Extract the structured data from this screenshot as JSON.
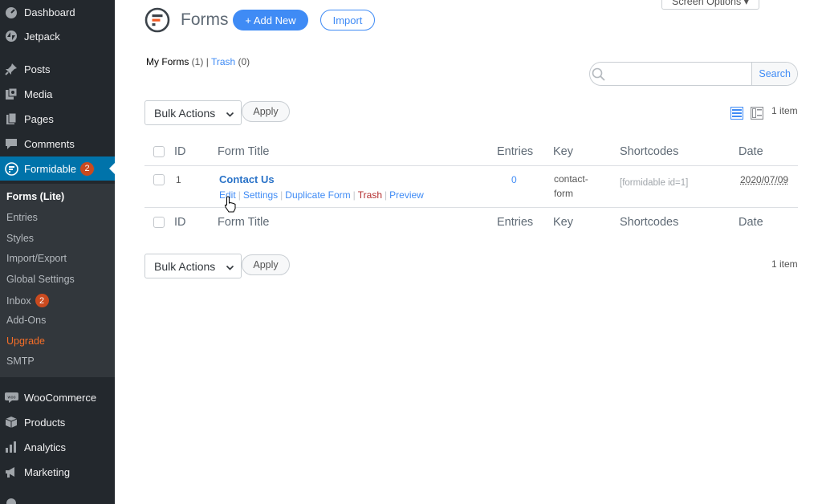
{
  "sidebar": {
    "top_items": [
      {
        "label": "Dashboard",
        "icon": "dashboard-icon"
      },
      {
        "label": "Jetpack",
        "icon": "jetpack-icon"
      },
      {
        "label": "Posts",
        "icon": "pin-icon"
      },
      {
        "label": "Media",
        "icon": "media-icon"
      },
      {
        "label": "Pages",
        "icon": "pages-icon"
      },
      {
        "label": "Comments",
        "icon": "comment-icon"
      },
      {
        "label": "Formidable",
        "icon": "formidable-icon",
        "badge": "2"
      }
    ],
    "submenu": [
      {
        "label": "Forms (Lite)"
      },
      {
        "label": "Entries"
      },
      {
        "label": "Styles"
      },
      {
        "label": "Import/Export"
      },
      {
        "label": "Global Settings"
      },
      {
        "label": "Inbox",
        "badge": "2"
      },
      {
        "label": "Add-Ons"
      },
      {
        "label": "Upgrade"
      },
      {
        "label": "SMTP"
      }
    ],
    "bottom_items": [
      {
        "label": "WooCommerce",
        "icon": "woo-icon"
      },
      {
        "label": "Products",
        "icon": "box-icon"
      },
      {
        "label": "Analytics",
        "icon": "bar-chart-icon"
      },
      {
        "label": "Marketing",
        "icon": "megaphone-icon"
      }
    ]
  },
  "header": {
    "screen_options": "Screen Options ▾",
    "title": "Forms",
    "add_new": "+ Add New",
    "import": "Import"
  },
  "views": {
    "my_forms": "My Forms",
    "my_forms_count": "(1)",
    "separator": "|",
    "trash": "Trash",
    "trash_count": "(0)"
  },
  "search": {
    "button": "Search",
    "placeholder": ""
  },
  "bulk": {
    "label": "Bulk Actions",
    "apply": "Apply"
  },
  "items_count": "1 item",
  "table": {
    "columns": [
      "ID",
      "Form Title",
      "Entries",
      "Key",
      "Shortcodes",
      "Date"
    ],
    "rows": [
      {
        "id": "1",
        "title": "Contact Us",
        "actions": [
          "Edit",
          "Settings",
          "Duplicate Form",
          "Trash",
          "Preview"
        ],
        "entries": "0",
        "key_line1": "contact-",
        "key_line2": "form",
        "shortcode": "[formidable id=1]",
        "date": "2020/07/09"
      }
    ]
  },
  "colors": {
    "sidebar": "#23282d",
    "active": "#0073aa",
    "accent": "#3f8bf5",
    "badge": "#ca4a1f"
  }
}
